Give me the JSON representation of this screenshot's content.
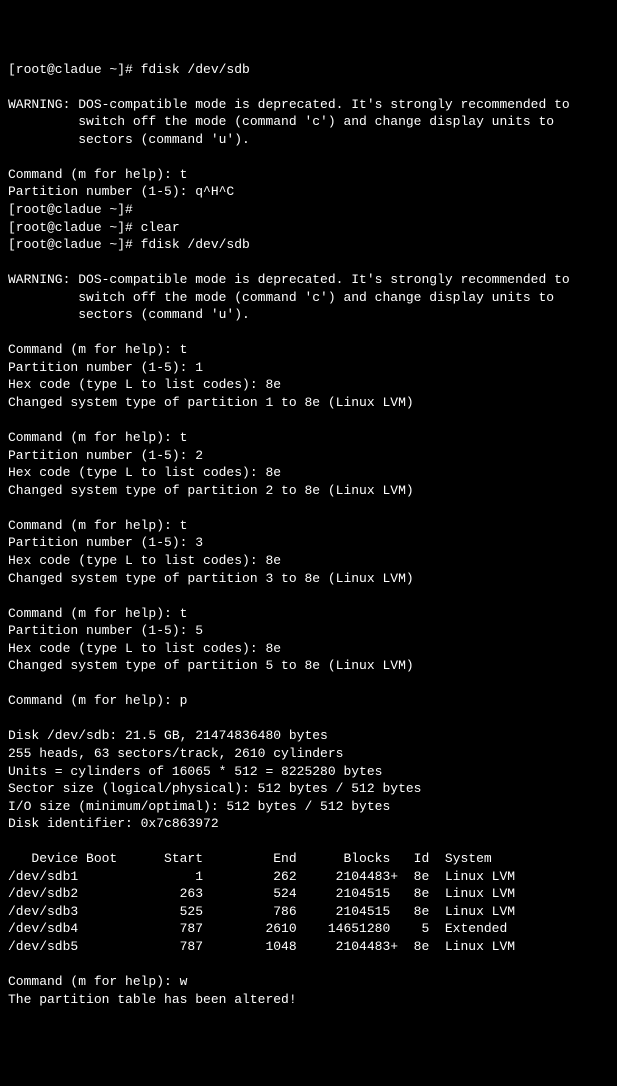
{
  "lines": [
    "[root@cladue ~]# fdisk /dev/sdb",
    "",
    "WARNING: DOS-compatible mode is deprecated. It's strongly recommended to",
    "         switch off the mode (command 'c') and change display units to",
    "         sectors (command 'u').",
    "",
    "Command (m for help): t",
    "Partition number (1-5): q^H^C",
    "[root@cladue ~]#",
    "[root@cladue ~]# clear",
    "[root@cladue ~]# fdisk /dev/sdb",
    "",
    "WARNING: DOS-compatible mode is deprecated. It's strongly recommended to",
    "         switch off the mode (command 'c') and change display units to",
    "         sectors (command 'u').",
    "",
    "Command (m for help): t",
    "Partition number (1-5): 1",
    "Hex code (type L to list codes): 8e",
    "Changed system type of partition 1 to 8e (Linux LVM)",
    "",
    "Command (m for help): t",
    "Partition number (1-5): 2",
    "Hex code (type L to list codes): 8e",
    "Changed system type of partition 2 to 8e (Linux LVM)",
    "",
    "Command (m for help): t",
    "Partition number (1-5): 3",
    "Hex code (type L to list codes): 8e",
    "Changed system type of partition 3 to 8e (Linux LVM)",
    "",
    "Command (m for help): t",
    "Partition number (1-5): 5",
    "Hex code (type L to list codes): 8e",
    "Changed system type of partition 5 to 8e (Linux LVM)",
    "",
    "Command (m for help): p",
    "",
    "Disk /dev/sdb: 21.5 GB, 21474836480 bytes",
    "255 heads, 63 sectors/track, 2610 cylinders",
    "Units = cylinders of 16065 * 512 = 8225280 bytes",
    "Sector size (logical/physical): 512 bytes / 512 bytes",
    "I/O size (minimum/optimal): 512 bytes / 512 bytes",
    "Disk identifier: 0x7c863972",
    "",
    "   Device Boot      Start         End      Blocks   Id  System",
    "/dev/sdb1               1         262     2104483+  8e  Linux LVM",
    "/dev/sdb2             263         524     2104515   8e  Linux LVM",
    "/dev/sdb3             525         786     2104515   8e  Linux LVM",
    "/dev/sdb4             787        2610    14651280    5  Extended",
    "/dev/sdb5             787        1048     2104483+  8e  Linux LVM",
    "",
    "Command (m for help): w",
    "The partition table has been altered!"
  ]
}
